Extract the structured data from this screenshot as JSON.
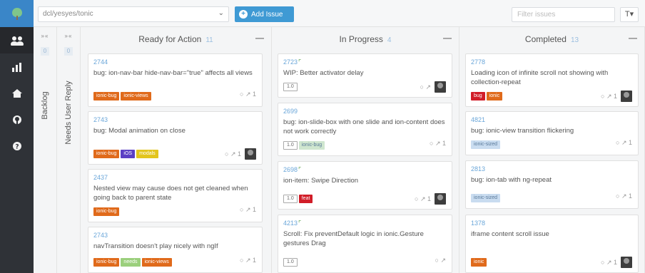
{
  "topbar": {
    "repo": "dcl/yesyes/tonic",
    "add_label": "Add Issue",
    "filter_placeholder": "Filter issues",
    "filter_icon": "T▾"
  },
  "nav": {
    "items": [
      {
        "name": "team-icon",
        "glyph": "⚉"
      },
      {
        "name": "chart-icon",
        "glyph": "▁▃▅"
      },
      {
        "name": "home-icon",
        "glyph": "⌂"
      },
      {
        "name": "github-icon",
        "glyph": "●"
      },
      {
        "name": "help-icon",
        "glyph": "?"
      }
    ]
  },
  "lanes_collapsed": [
    {
      "label": "Backlog",
      "arrows": "»«",
      "count": "0"
    },
    {
      "label": "Needs User Reply",
      "arrows": "»«",
      "count": "0"
    }
  ],
  "columns": [
    {
      "title": "Ready for Action",
      "count": "11",
      "menu": "—",
      "cards": [
        {
          "num": "2744",
          "title": "bug: ion-nav-bar hide-nav-bar=\"true\" affects all views",
          "tags": [
            {
              "t": "ionic-bug",
              "c": "#e06a1b"
            },
            {
              "t": "ionic-views",
              "c": "#e06a1b"
            }
          ],
          "meta": "○ ↗ 1",
          "avatar": false
        },
        {
          "num": "2743",
          "title": "bug: Modal animation on close",
          "tags": [
            {
              "t": "ionic-bug",
              "c": "#e06a1b"
            },
            {
              "t": "iOS",
              "c": "#5b3fc4"
            },
            {
              "t": "modals",
              "c": "#e3c51c"
            }
          ],
          "meta": "○ ↗ 1",
          "avatar": true
        },
        {
          "num": "2437",
          "title": "Nested view may cause does not get cleaned when going back to parent state",
          "tags": [
            {
              "t": "ionic-bug",
              "c": "#e06a1b"
            }
          ],
          "meta": "○ ↗ 1",
          "avatar": false
        },
        {
          "num": "2743",
          "title": "navTransition doesn't play nicely with ngIf",
          "tags": [
            {
              "t": "ionic-bug",
              "c": "#e06a1b"
            },
            {
              "t": "needs",
              "c": "#9bcf7c"
            },
            {
              "t": "ionic-views",
              "c": "#e06a1b"
            }
          ],
          "meta": "○ ↗ 1",
          "avatar": false
        }
      ]
    },
    {
      "title": "In Progress",
      "count": "4",
      "menu": "—",
      "cards": [
        {
          "num": "2723",
          "pr": true,
          "title": "WIP: Better activator delay",
          "tags": [
            {
              "t": "1.0",
              "c": "points"
            }
          ],
          "meta": "○ ↗",
          "avatar": true
        },
        {
          "num": "2699",
          "title": "bug: ion-slide-box with one slide and ion-content does not work correctly",
          "tags": [
            {
              "t": "1.0",
              "c": "points"
            },
            {
              "t": "ionic-bug",
              "c": "#cfe6cf",
              "dark": true
            }
          ],
          "meta": "○ ↗ 1",
          "avatar": false
        },
        {
          "num": "2698",
          "pr": true,
          "title": "ion-item: Swipe Direction",
          "tags": [
            {
              "t": "1.0",
              "c": "points"
            },
            {
              "t": "feat",
              "c": "#d11d28"
            }
          ],
          "meta": "○ ↗ 1",
          "avatar": true
        },
        {
          "num": "4213",
          "pr": true,
          "title": "Scroll: Fix preventDefault logic in ionic.Gesture gestures Drag",
          "tags": [
            {
              "t": "1.0",
              "c": "points"
            }
          ],
          "meta": "○ ↗",
          "avatar": false
        }
      ]
    },
    {
      "title": "Completed",
      "count": "13",
      "menu": "—",
      "cards": [
        {
          "num": "2778",
          "title": "Loading icon of infinite scroll not showing with collection-repeat",
          "tags": [
            {
              "t": "bug",
              "c": "#d11d28"
            },
            {
              "t": "ionic",
              "c": "#e06a1b"
            }
          ],
          "meta": "○ ↗ 1",
          "avatar": true
        },
        {
          "num": "4821",
          "title": "bug: ionic-view transition flickering",
          "tags": [
            {
              "t": "ionic-sized",
              "c": "#c9dcf0",
              "dark": true
            }
          ],
          "meta": "○ ↗ 1",
          "avatar": false
        },
        {
          "num": "2813",
          "title": "bug: ion-tab with ng-repeat",
          "tags": [
            {
              "t": "ionic-sized",
              "c": "#c9dcf0",
              "dark": true
            }
          ],
          "meta": "○ ↗ 1",
          "avatar": false
        },
        {
          "num": "1378",
          "title": "iframe content scroll issue",
          "tags": [
            {
              "t": "ionic",
              "c": "#e06a1b"
            }
          ],
          "meta": "○ ↗ 1",
          "avatar": true
        }
      ]
    }
  ]
}
